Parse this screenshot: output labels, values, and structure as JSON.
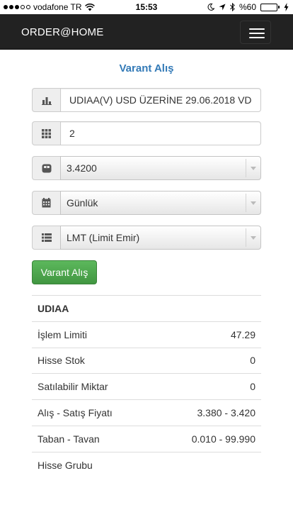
{
  "status_bar": {
    "carrier": "vodafone TR",
    "time": "15:53",
    "battery": "%60",
    "battery_level": 0.6
  },
  "navbar": {
    "brand": "ORDER@HOME"
  },
  "page": {
    "title": "Varant Alış"
  },
  "form": {
    "instrument": "UDIAA(V)      USD ÜZERİNE 29.06.2018 VD",
    "quantity": "2",
    "price": "3.4200",
    "validity": "Günlük",
    "order_type": "LMT (Limit Emir)",
    "submit_label": "Varant Alış"
  },
  "info": {
    "header": "UDIAA",
    "rows": [
      {
        "label": "İşlem Limiti",
        "value": "47.29"
      },
      {
        "label": "Hisse Stok",
        "value": "0"
      },
      {
        "label": "Satılabilir Miktar",
        "value": "0"
      },
      {
        "label": "Alış - Satış Fiyatı",
        "value": "3.380 - 3.420"
      },
      {
        "label": "Taban - Tavan",
        "value": "0.010 - 99.990"
      },
      {
        "label": "Hisse Grubu",
        "value": ""
      }
    ]
  },
  "colors": {
    "navbar": "#222222",
    "title": "#337ab7",
    "buy_button": "#47a447",
    "battery_fill": "#4cd964"
  }
}
